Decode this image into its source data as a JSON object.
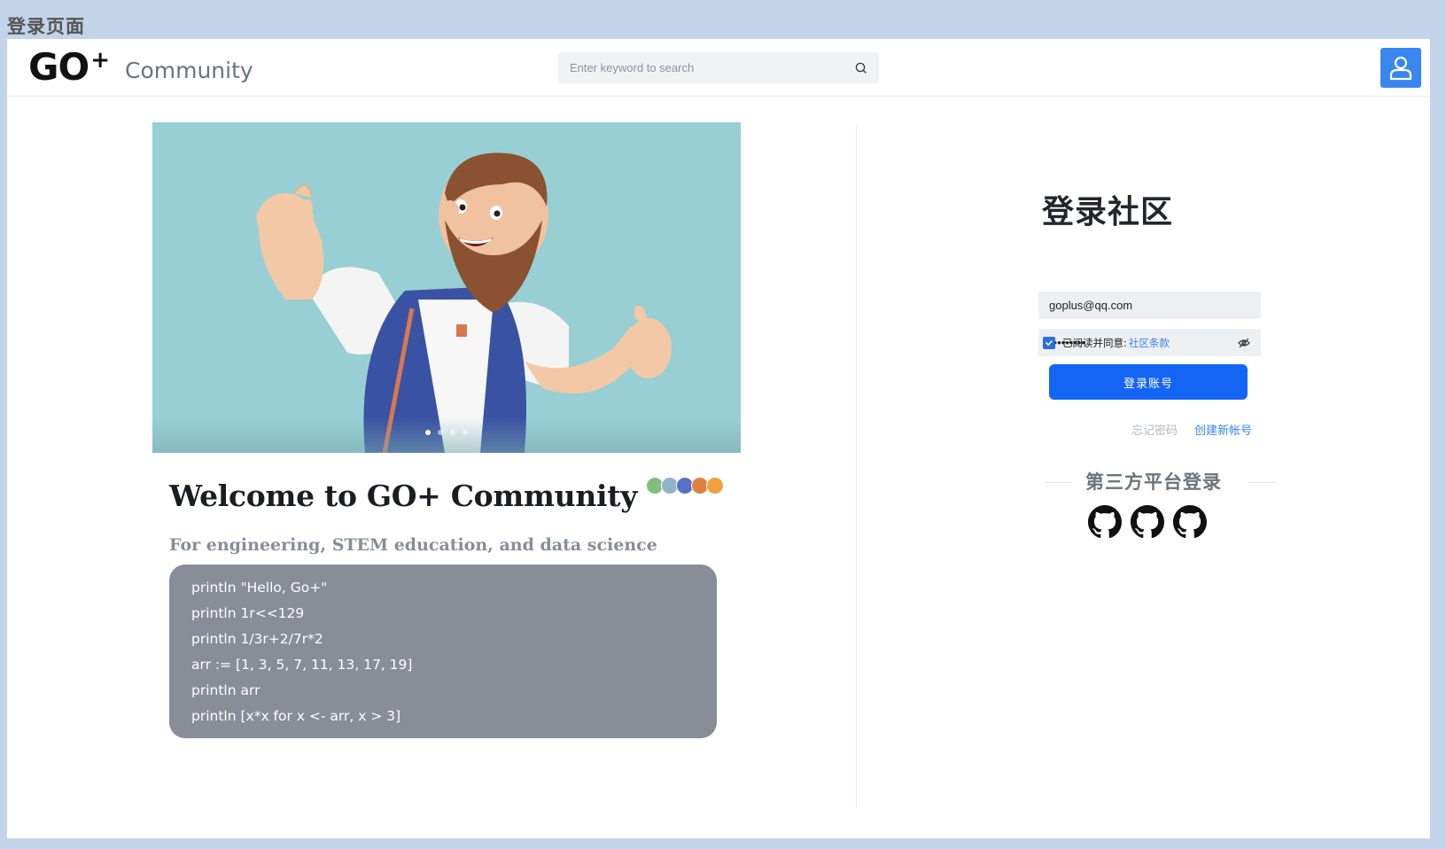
{
  "page_caption": "登录页面",
  "header": {
    "logo_text": "GO",
    "logo_plus": "+",
    "logo_sub": "Community",
    "search_placeholder": "Enter keyword to search"
  },
  "hero": {
    "slide_count": 4,
    "active_slide": 1
  },
  "intro": {
    "welcome": "Welcome to GO+ Community",
    "tagline": "For engineering, STEM education, and data science",
    "avatar_colors": [
      "#7fbf7f",
      "#8fb4c7",
      "#5670c8",
      "#e08040",
      "#f0a040"
    ],
    "code_lines": [
      "println \"Hello, Go+\"",
      "println 1r<<129",
      "println 1/3r+2/7r*2",
      "arr := [1, 3, 5, 7, 11, 13, 17, 19]",
      "println arr",
      "println [x*x for x <- arr, x > 3]"
    ]
  },
  "login": {
    "title": "登录社区",
    "email_value": "goplus@qq.com",
    "password_value": "•••••••••",
    "agree_text": "已阅读并同意:",
    "agree_link": "社区条款",
    "submit_label": "登录账号",
    "forgot_label": "忘记密码",
    "create_label": "创建新帐号",
    "third_party_title": "第三方平台登录",
    "third_party_count": 3
  },
  "colors": {
    "accent": "#1565f4",
    "link": "#3a86ef",
    "hero_bg": "#97cfd4",
    "code_bg": "#888d98",
    "page_bg": "#c3d3e9"
  }
}
